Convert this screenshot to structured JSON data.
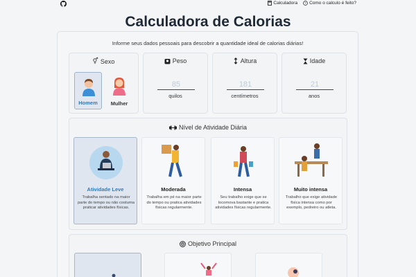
{
  "topnav": {
    "calculator": "Calculadora",
    "how": "Como o calculo é feito?"
  },
  "title": "Calculadora de Calorias",
  "subtitle": "Informe seus dados pessoais para descobrir a quantidade ideal de calorias diárias!",
  "sex": {
    "label": "Sexo",
    "options": [
      "Homem",
      "Mulher"
    ],
    "selected": "Homem"
  },
  "weight": {
    "label": "Peso",
    "value": "85",
    "unit": "quilos"
  },
  "height": {
    "label": "Altura",
    "value": "181",
    "unit": "centímetros"
  },
  "age": {
    "label": "Idade",
    "value": "21",
    "unit": "anos"
  },
  "activity": {
    "label": "Nível de Atividade Diária",
    "selected": "Atividade Leve",
    "options": [
      {
        "name": "Atividade Leve",
        "desc": "Trabalha sentado na maior parte do tempo ou não costuma praticar atividades físicas."
      },
      {
        "name": "Moderada",
        "desc": "Trabalha em pé na maior parte do tempo ou pratica atividades físicas regularmente."
      },
      {
        "name": "Intensa",
        "desc": "Seu trabalho exige que se locomova bastante e pratica atividades físicas regularmente."
      },
      {
        "name": "Muito intensa",
        "desc": "Trabalho que exige atividade física intensa como por exemplo, pedreiro ou atleta."
      }
    ]
  },
  "goal": {
    "label": "Objetivo Principal"
  },
  "colors": {
    "accent": "#2f7bc0",
    "selected_bg": "#dfe6ef",
    "text": "#1f2a37"
  }
}
